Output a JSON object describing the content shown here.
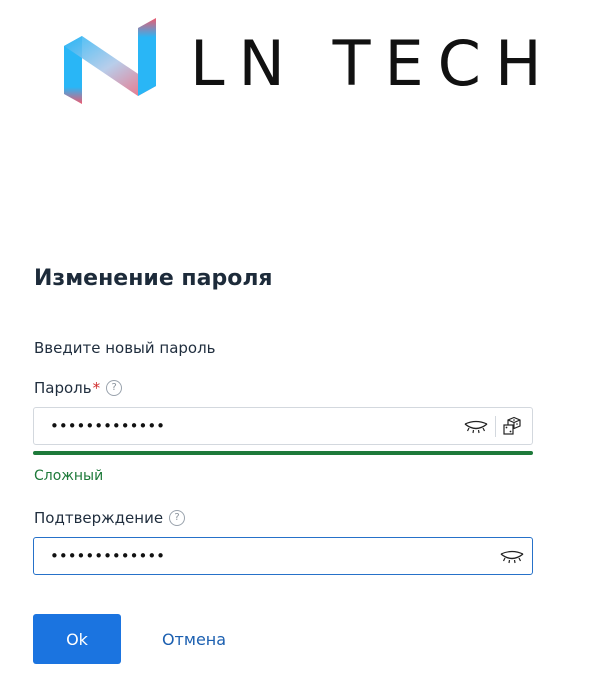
{
  "logo": {
    "text": "LN TECH",
    "colors": {
      "blue": "#29b6f6",
      "red": "#ef5a6f",
      "text": "#111111"
    }
  },
  "form": {
    "title": "Изменение пароля",
    "subtitle": "Введите новый пароль",
    "password": {
      "label": "Пароль",
      "required_mark": "*",
      "help_icon": "question-circle-icon",
      "value": "•••••••••••••",
      "show_icon": "eye-closed-icon",
      "generate_icon": "dice-icon"
    },
    "strength": {
      "label": "Сложный",
      "level": 1.0,
      "color": "#1e7a3a"
    },
    "confirm": {
      "label": "Подтверждение",
      "help_icon": "question-circle-icon",
      "value": "•••••••••••••",
      "show_icon": "eye-closed-icon"
    },
    "ok_label": "Ok",
    "cancel_label": "Отмена"
  },
  "colors": {
    "primary": "#1b74e0",
    "link": "#1b5fb0",
    "required": "#d02a2a",
    "focus_border": "#2671c9"
  }
}
